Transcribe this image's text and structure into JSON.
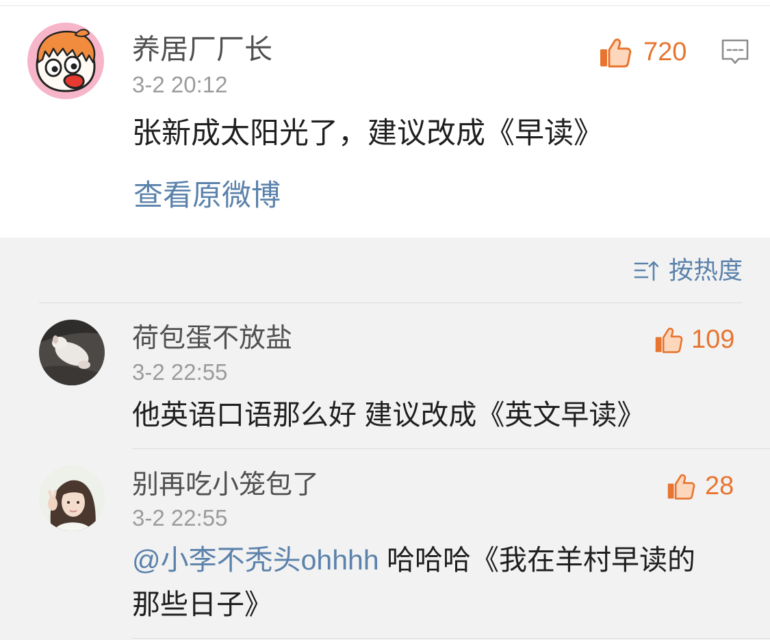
{
  "main_comment": {
    "username": "养居厂厂长",
    "timestamp": "3-2 20:12",
    "like_count": "720",
    "text": "张新成太阳光了，建议改成《早读》",
    "view_original_label": "查看原微博"
  },
  "sort": {
    "label": "按热度"
  },
  "replies": [
    {
      "username": "荷包蛋不放盐",
      "timestamp": "3-2 22:55",
      "like_count": "109",
      "text": "他英语口语那么好 建议改成《英文早读》"
    },
    {
      "username": "别再吃小笼包了",
      "timestamp": "3-2 22:55",
      "like_count": "28",
      "mention": "@小李不秃头ohhhh",
      "text": "哈哈哈《我在羊村早读的那些日子》"
    }
  ],
  "icons": {
    "like": "thumbs-up-icon",
    "reply": "comment-icon",
    "sort": "sort-icon"
  },
  "colors": {
    "like_orange": "#e8742f",
    "link_blue": "#5b82ab",
    "username_gray": "#505050",
    "timestamp_gray": "#9b9b9b",
    "text_dark": "#1f1f1f",
    "section_gray": "#f2f2f2",
    "divider": "#dddddd"
  }
}
